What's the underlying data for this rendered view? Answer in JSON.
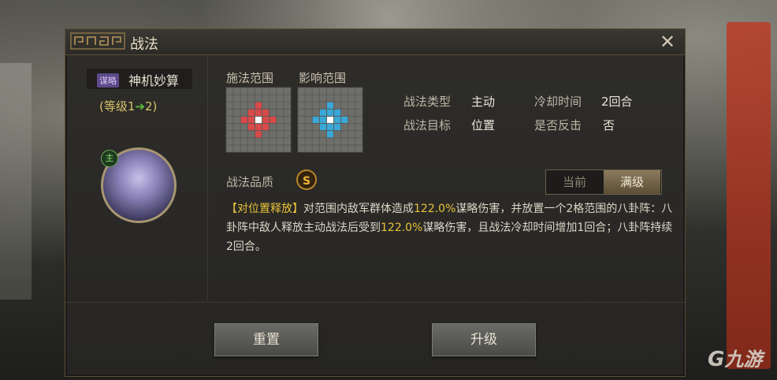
{
  "dialog": {
    "title": "战法",
    "close_icon": "close-icon"
  },
  "skill": {
    "type_tag": "谋略",
    "name": "神机妙算",
    "level_prefix": "(等级1",
    "level_arrow": "➔",
    "level_suffix": "2)",
    "portrait_badge": "主"
  },
  "ranges": {
    "cast_label": "施法范围",
    "effect_label": "影响范围",
    "cast_color": "#d94a4a",
    "effect_color": "#3aa8d8"
  },
  "info": {
    "type_label": "战法类型",
    "type_value": "主动",
    "target_label": "战法目标",
    "target_value": "位置",
    "cooldown_label": "冷却时间",
    "cooldown_value": "2回合",
    "counter_label": "是否反击",
    "counter_value": "否"
  },
  "quality": {
    "label": "战法品质",
    "grade": "S"
  },
  "toggle": {
    "current": "当前",
    "max": "满级"
  },
  "description": {
    "tag": "【对位置释放】",
    "p1": "对范围内敌军群体造成",
    "n1": "122.0%",
    "p2": "谋略伤害，并放置一个2格范围的八卦阵：八卦阵中敌人释放主动战法后受到",
    "n2": "122.0%",
    "p3": "谋略伤害，且战法冷却时间增加1回合；八卦阵持续2回合。"
  },
  "buttons": {
    "reset": "重置",
    "upgrade": "升级"
  },
  "watermark": "九游"
}
